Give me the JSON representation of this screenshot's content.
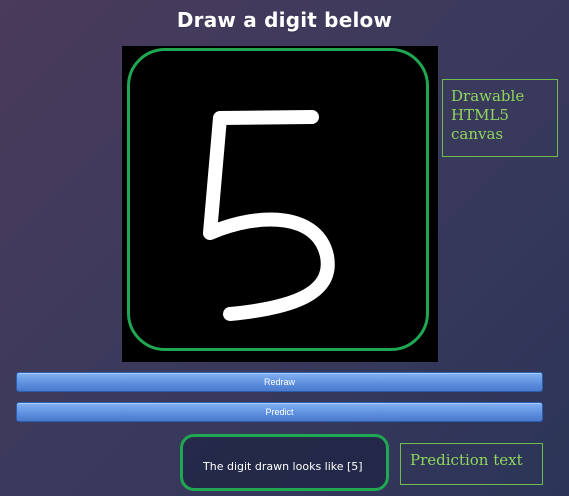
{
  "header": {
    "title": "Draw a digit below"
  },
  "canvas": {
    "drawn_digit": "5",
    "annotation": "Drawable HTML5 canvas",
    "colors": {
      "background": "#000000",
      "stroke": "#ffffff",
      "highlight": "#1fa752"
    }
  },
  "buttons": {
    "redraw_label": "Redraw",
    "predict_label": "Predict"
  },
  "prediction": {
    "text": "The digit drawn looks like [5]",
    "annotation": "Prediction text"
  },
  "colors": {
    "annotation_text": "#8fd65e",
    "button": "#5f91df"
  }
}
